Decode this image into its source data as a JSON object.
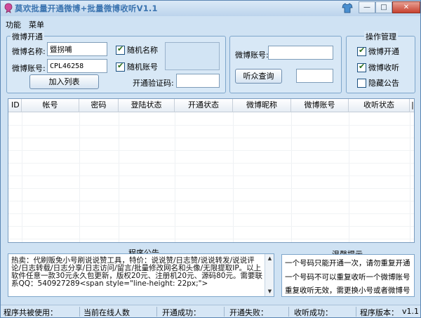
{
  "window": {
    "title": "莫欢批量开通微博+批量微博收听V1.1",
    "buttons": {
      "minimize": "—",
      "maximize": "□",
      "close": "✕"
    }
  },
  "menu": {
    "items": [
      "功能",
      "菜单"
    ]
  },
  "weibo_open": {
    "group_title": "微博开通",
    "name_label": "微博名称:",
    "name_value": "暨拐哺",
    "random_name_label": "随机名称",
    "random_name_checked": true,
    "account_label": "微博账号:",
    "account_value": "CPL46258",
    "random_account_label": "随机账号",
    "random_account_checked": true,
    "add_button": "加入列表",
    "captcha_label": "开通验证码:",
    "captcha_value": ""
  },
  "listen": {
    "account_label": "微博账号:",
    "account_value": "",
    "query_button": "听众查询",
    "result_value": ""
  },
  "ops": {
    "group_title": "操作管理",
    "open_label": "微博开通",
    "open_checked": true,
    "listen_label": "微博收听",
    "listen_checked": true,
    "hide_label": "隐藏公告",
    "hide_checked": false
  },
  "table": {
    "columns": [
      "ID",
      "帐号",
      "密码",
      "登陆状态",
      "开通状态",
      "微博昵称",
      "微博账号",
      "收听状态",
      "|"
    ],
    "rows": []
  },
  "notice": {
    "group_title": "程序公告",
    "text": "      热卖：代刷贩免小号刷说说赞工具，特价：说说赞/日志赞/说说转发/说说评论/日志转载/日志分享/日志访问/留言/批量修改网名和头像/无限提取IP。以上软件任意一款30元永久包更新，版权20元、注册机20元、源码80元。需要联系QQ：540927289<span style=\"line-height: 22px;\">"
  },
  "tips": {
    "group_title": "温馨提示",
    "lines": [
      "一个号码只能开通一次，请勿重复开通",
      "一个号码不可以重复收听一个微博账号",
      "重复收听无效，需更换小号或者微博号"
    ]
  },
  "status_bar": {
    "shared": "程序共被使用：",
    "online": "当前在线人数",
    "open_ok": "开通成功：",
    "open_fail": "开通失败：",
    "listen_ok": "收听成功：",
    "version_label": "程序版本：",
    "version": "v1.1"
  }
}
